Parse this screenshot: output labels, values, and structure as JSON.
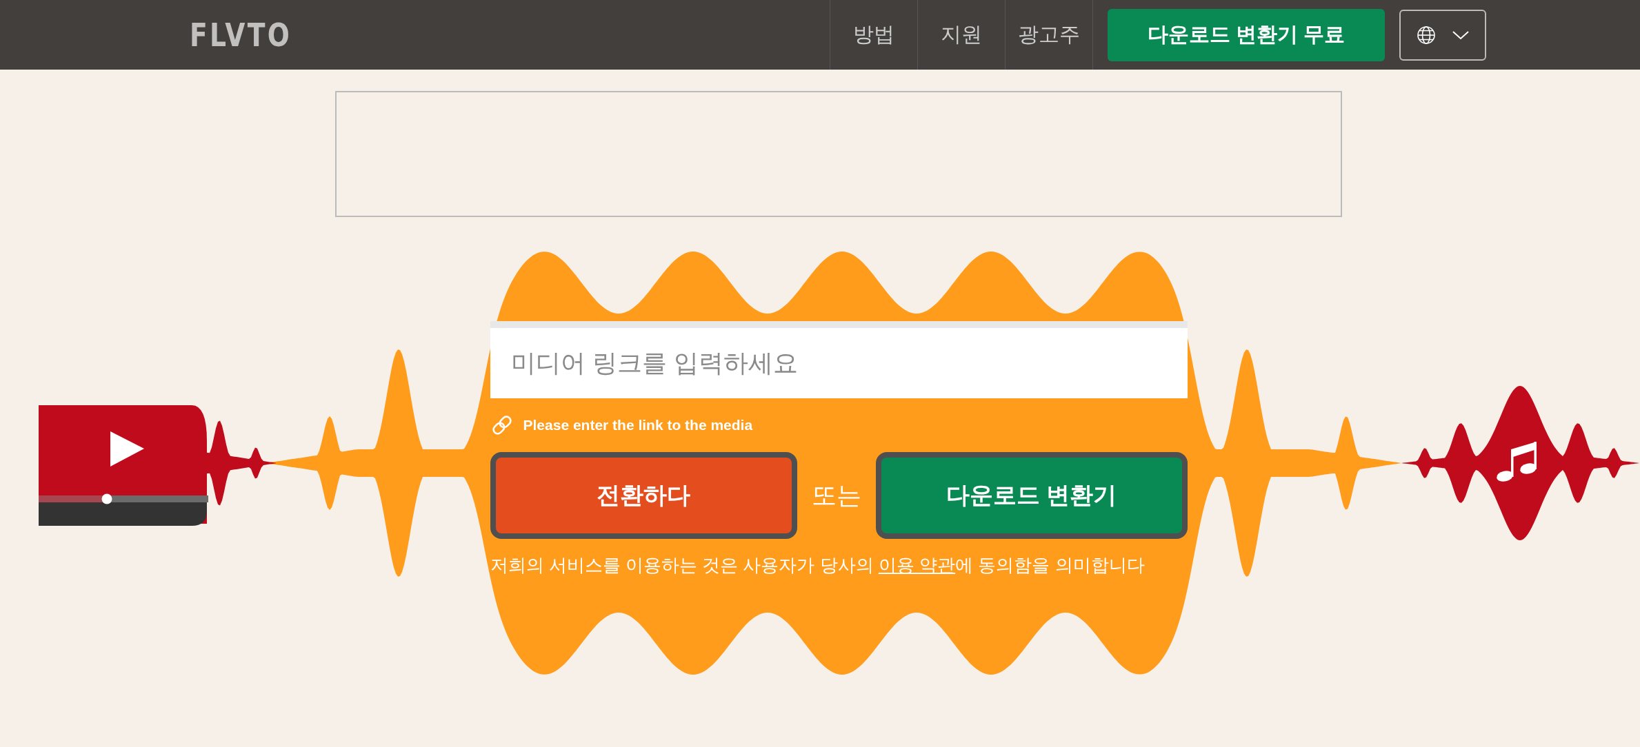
{
  "header": {
    "logo": "FLVTO",
    "nav": [
      {
        "label": "방법"
      },
      {
        "label": "지원"
      },
      {
        "label": "광고주"
      }
    ],
    "download_button": "다운로드 변환기 무료"
  },
  "converter": {
    "input": {
      "placeholder": "미디어 링크를 입력하세요"
    },
    "hint": "Please enter the link to the media",
    "convert_button": "전환하다",
    "separator": "또는",
    "download_button": "다운로드 변환기",
    "terms": {
      "before": "저희의 서비스를 이용하는 것은 사용자가 당사의 ",
      "link": "이용 약관",
      "after": "에 동의함을 의미합니다"
    }
  }
}
